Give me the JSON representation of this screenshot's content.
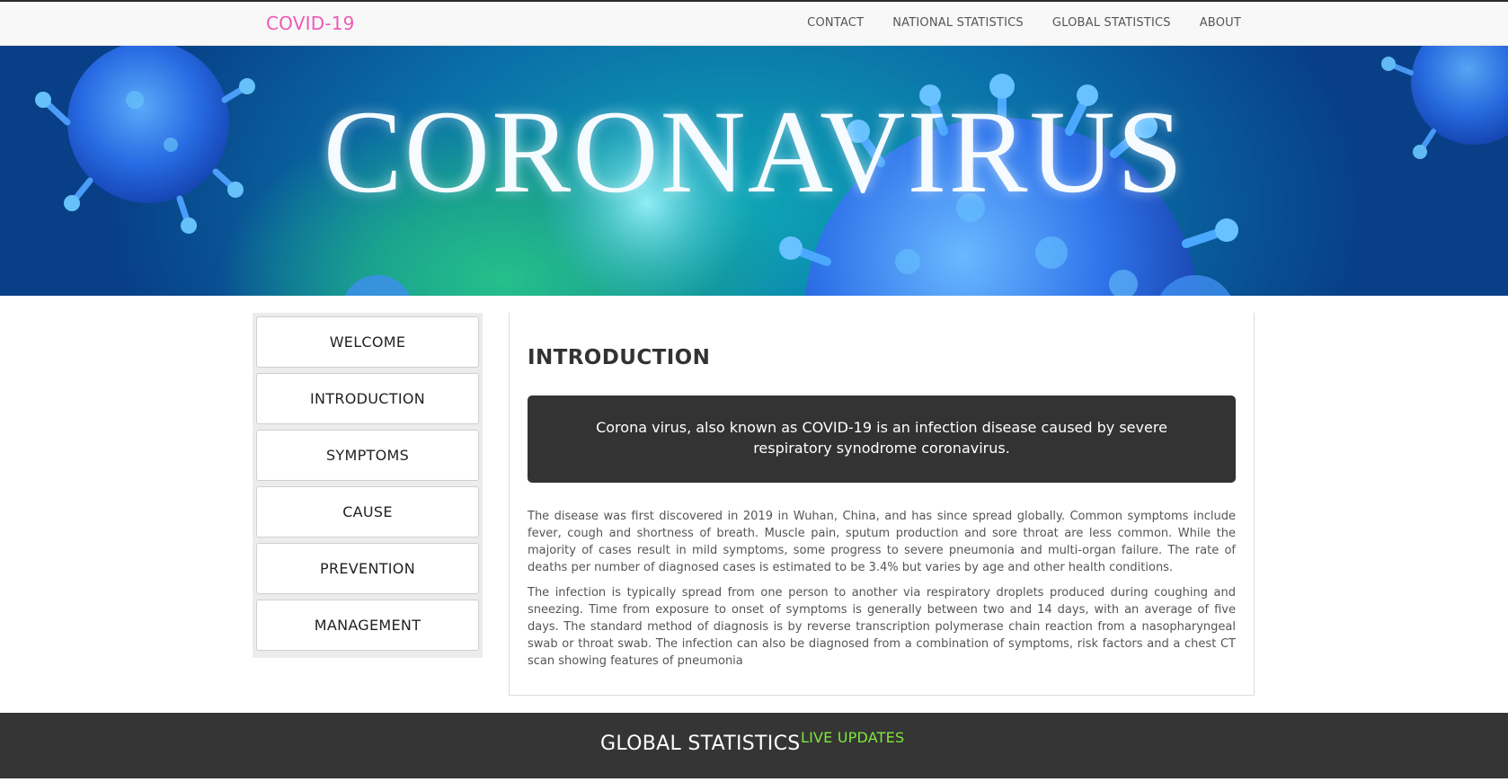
{
  "navbar": {
    "brand": "COVID-19",
    "links": [
      "CONTACT",
      "NATIONAL STATISTICS",
      "GLOBAL STATISTICS",
      "ABOUT"
    ]
  },
  "hero": {
    "title": "CORONAVIRUS"
  },
  "sidebar": {
    "items": [
      {
        "label": "WELCOME"
      },
      {
        "label": "INTRODUCTION"
      },
      {
        "label": "SYMPTOMS"
      },
      {
        "label": "CAUSE"
      },
      {
        "label": "PREVENTION"
      },
      {
        "label": "MANAGEMENT"
      }
    ]
  },
  "main": {
    "title": "INTRODUCTION",
    "callout": "Corona virus, also known as COVID-19 is an infection disease caused by severe respiratory synodrome coronavirus.",
    "paragraphs": [
      "The disease was first discovered in 2019 in Wuhan, China, and has since spread globally. Common symptoms include fever, cough and shortness of breath. Muscle pain, sputum production and sore throat are less common. While the majority of cases result in mild symptoms, some progress to severe pneumonia and multi-organ failure. The rate of deaths per number of diagnosed cases is estimated to be 3.4% but varies by age and other health conditions.",
      "The infection is typically spread from one person to another via respiratory droplets produced during coughing and sneezing. Time from exposure to onset of symptoms is generally between two and 14 days, with an average of five days. The standard method of diagnosis is by reverse transcription polymerase chain reaction from a nasopharyngeal swab or throat swab. The infection can also be diagnosed from a combination of symptoms, risk factors and a chest CT scan showing features of pneumonia"
    ]
  },
  "footer": {
    "title": "GLOBAL STATISTICS",
    "live": "LIVE UPDATES"
  },
  "colors": {
    "brand": "#ee5ab4",
    "live": "#7ee83c",
    "dark": "#333333"
  }
}
